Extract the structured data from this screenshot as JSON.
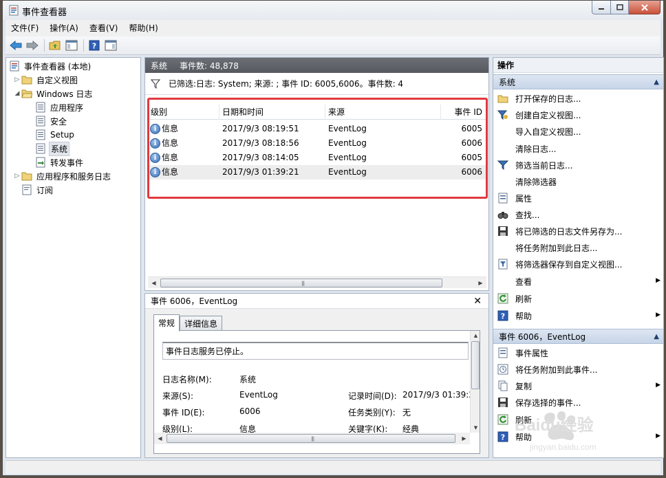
{
  "window": {
    "title": "事件查看器"
  },
  "menu": [
    "文件(F)",
    "操作(A)",
    "查看(V)",
    "帮助(H)"
  ],
  "tree": {
    "root": "事件查看器 (本地)",
    "custom_views": "自定义视图",
    "windows_logs": "Windows 日志",
    "logs": [
      "应用程序",
      "安全",
      "Setup",
      "系统",
      "转发事件"
    ],
    "app_services": "应用程序和服务日志",
    "subscriptions": "订阅"
  },
  "center": {
    "header_name": "系统",
    "header_count": "事件数: 48,878",
    "filter_text": "已筛选:日志: System; 来源: ; 事件 ID: 6005,6006。事件数: 4",
    "columns": [
      "级别",
      "日期和时间",
      "来源",
      "事件 ID"
    ],
    "rows": [
      {
        "level": "信息",
        "datetime": "2017/9/3 08:19:51",
        "source": "EventLog",
        "id": "6005"
      },
      {
        "level": "信息",
        "datetime": "2017/9/3 08:18:56",
        "source": "EventLog",
        "id": "6006"
      },
      {
        "level": "信息",
        "datetime": "2017/9/3 08:14:05",
        "source": "EventLog",
        "id": "6005"
      },
      {
        "level": "信息",
        "datetime": "2017/9/3 01:39:21",
        "source": "EventLog",
        "id": "6006"
      }
    ]
  },
  "detail": {
    "title": "事件 6006，EventLog",
    "tabs": [
      "常规",
      "详细信息"
    ],
    "description": "事件日志服务已停止。",
    "log_name_label": "日志名称(M):",
    "log_name_value": "系统",
    "source_label": "来源(S):",
    "source_value": "EventLog",
    "logged_label": "记录时间(D):",
    "logged_value": "2017/9/3 01:39:2",
    "event_id_label": "事件 ID(E):",
    "event_id_value": "6006",
    "task_label": "任务类别(Y):",
    "task_value": "无",
    "level_label": "级别(L):",
    "level_value": "信息",
    "keywords_label": "关键字(K):",
    "keywords_value": "经典"
  },
  "actions": {
    "title": "操作",
    "section1": "系统",
    "items1": [
      "打开保存的日志...",
      "创建自定义视图...",
      "导入自定义视图...",
      "清除日志...",
      "筛选当前日志...",
      "清除筛选器",
      "属性",
      "查找...",
      "将已筛选的日志文件另存为...",
      "将任务附加到此日志...",
      "将筛选器保存到自定义视图...",
      "查看",
      "刷新",
      "帮助"
    ],
    "section2": "事件 6006，EventLog",
    "items2": [
      "事件属性",
      "将任务附加到此事件...",
      "复制",
      "保存选择的事件...",
      "刷新",
      "帮助"
    ]
  },
  "watermark": {
    "text": "Baidu经验",
    "url": "jingyan.baidu.com"
  },
  "colors": {
    "highlight_frame": "#e0393e",
    "pane_header": "#5e6166",
    "section_header": "#c7d5e8"
  }
}
